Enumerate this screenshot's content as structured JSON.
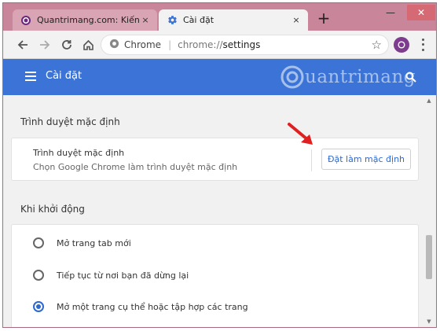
{
  "tabs": [
    {
      "title": "Quantrimang.com: Kiến Thức Công Nghệ",
      "active": false
    },
    {
      "title": "Cài đặt",
      "active": true
    }
  ],
  "tab_close_symbol": "×",
  "new_tab_symbol": "+",
  "window_controls": {
    "minimize": "—",
    "close": "✕"
  },
  "toolbar": {
    "site_name": "Chrome",
    "url_scheme": "chrome://",
    "url_path": "settings"
  },
  "icons": {
    "back": "back-arrow-icon",
    "forward": "forward-arrow-icon",
    "reload": "reload-icon",
    "home": "home-icon",
    "site_info": "chrome-site-icon",
    "bookmark": "star-icon",
    "profile": "profile-icon",
    "menu": "more-vert-icon",
    "hamburger": "hamburger-menu-icon",
    "search": "search-icon",
    "settings_favicon": "gear-icon",
    "qt_favicon": "quantrimang-icon"
  },
  "header": {
    "title": "Cài đặt",
    "watermark": "uantrimang"
  },
  "sections": {
    "default_browser": {
      "heading": "Trình duyệt mặc định",
      "card_title": "Trình duyệt mặc định",
      "card_subtitle": "Chọn Google Chrome làm trình duyệt mặc định",
      "button_label": "Đặt làm mặc định"
    },
    "startup": {
      "heading": "Khi khởi động",
      "options": [
        {
          "label": "Mở trang tab mới",
          "selected": false
        },
        {
          "label": "Tiếp tục từ nơi bạn đã dừng lại",
          "selected": false
        },
        {
          "label": "Mở một trang cụ thể hoặc tập hợp các trang",
          "selected": true
        }
      ]
    }
  },
  "colors": {
    "header_bg": "#3b73d6",
    "accent": "#2f68cf",
    "frame": "#c9859a",
    "annotation_arrow": "#e02020"
  }
}
